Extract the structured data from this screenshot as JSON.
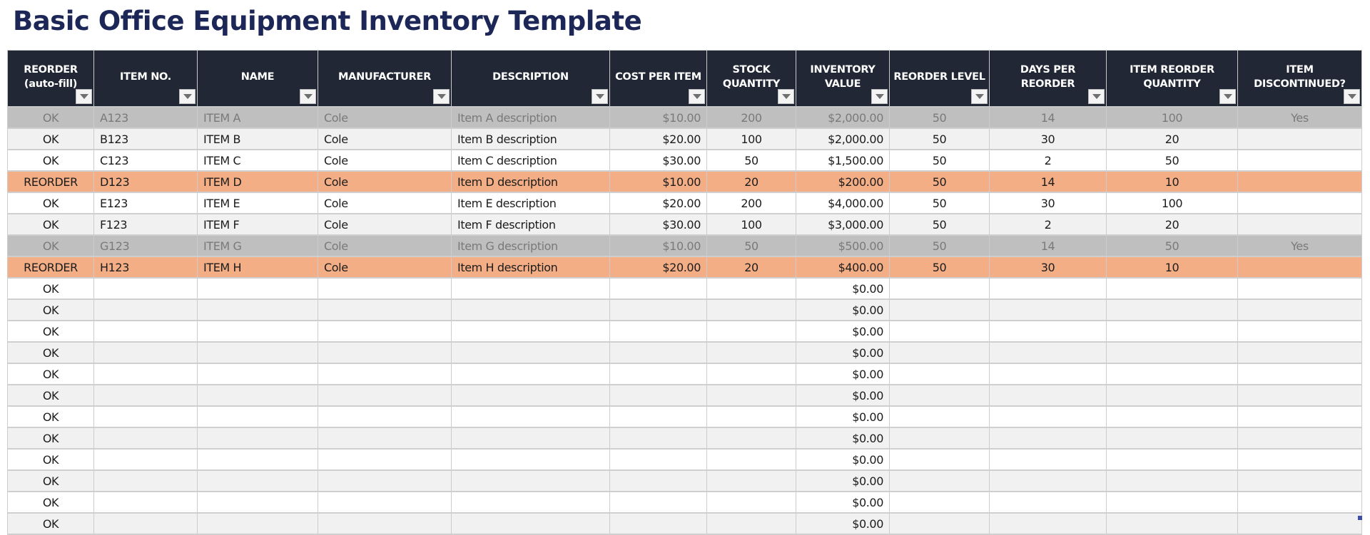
{
  "title": "Basic Office Equipment Inventory Template",
  "colors": {
    "header_bg": "#212735",
    "title_color": "#1d2757",
    "reorder_row": "#f3ae85",
    "discontinued_row": "#bfbfbf",
    "alt_row": "#f1f1f1"
  },
  "columns": [
    {
      "label": "REORDER (auto-fill)",
      "filter_icon": "filter-dropdown-icon"
    },
    {
      "label": "ITEM NO.",
      "filter_icon": "filter-dropdown-icon"
    },
    {
      "label": "NAME",
      "filter_icon": "filter-dropdown-icon"
    },
    {
      "label": "MANUFACTURER",
      "filter_icon": "filter-dropdown-icon"
    },
    {
      "label": "DESCRIPTION",
      "filter_icon": "filter-dropdown-icon"
    },
    {
      "label": "COST PER ITEM",
      "filter_icon": "filter-dropdown-icon"
    },
    {
      "label": "STOCK QUANTITY",
      "filter_icon": "filter-dropdown-icon"
    },
    {
      "label": "INVENTORY VALUE",
      "filter_icon": "filter-dropdown-icon"
    },
    {
      "label": "REORDER LEVEL",
      "filter_icon": "filter-dropdown-icon"
    },
    {
      "label": "DAYS PER REORDER",
      "filter_icon": "filter-dropdown-icon"
    },
    {
      "label": "ITEM REORDER QUANTITY",
      "filter_icon": "filter-dropdown-icon"
    },
    {
      "label": "ITEM DISCONTINUED?",
      "filter_icon": "filter-dropdown-icon"
    }
  ],
  "rows": [
    {
      "status": "disc",
      "cells": [
        "OK",
        "A123",
        "ITEM A",
        "Cole",
        "Item A description",
        "$10.00",
        "200",
        "$2,000.00",
        "50",
        "14",
        "100",
        "Yes"
      ]
    },
    {
      "status": "g",
      "cells": [
        "OK",
        "B123",
        "ITEM B",
        "Cole",
        "Item B description",
        "$20.00",
        "100",
        "$2,000.00",
        "50",
        "30",
        "20",
        ""
      ]
    },
    {
      "status": "w",
      "cells": [
        "OK",
        "C123",
        "ITEM C",
        "Cole",
        "Item C description",
        "$30.00",
        "50",
        "$1,500.00",
        "50",
        "2",
        "50",
        ""
      ]
    },
    {
      "status": "reo",
      "cells": [
        "REORDER",
        "D123",
        "ITEM D",
        "Cole",
        "Item D description",
        "$10.00",
        "20",
        "$200.00",
        "50",
        "14",
        "10",
        ""
      ]
    },
    {
      "status": "w",
      "cells": [
        "OK",
        "E123",
        "ITEM E",
        "Cole",
        "Item E description",
        "$20.00",
        "200",
        "$4,000.00",
        "50",
        "30",
        "100",
        ""
      ]
    },
    {
      "status": "g",
      "cells": [
        "OK",
        "F123",
        "ITEM F",
        "Cole",
        "Item F description",
        "$30.00",
        "100",
        "$3,000.00",
        "50",
        "2",
        "20",
        ""
      ]
    },
    {
      "status": "disc",
      "cells": [
        "OK",
        "G123",
        "ITEM G",
        "Cole",
        "Item G description",
        "$10.00",
        "50",
        "$500.00",
        "50",
        "14",
        "50",
        "Yes"
      ]
    },
    {
      "status": "reo",
      "cells": [
        "REORDER",
        "H123",
        "ITEM H",
        "Cole",
        "Item H description",
        "$20.00",
        "20",
        "$400.00",
        "50",
        "30",
        "10",
        ""
      ]
    },
    {
      "status": "w",
      "cells": [
        "OK",
        "",
        "",
        "",
        "",
        "",
        "",
        "$0.00",
        "",
        "",
        "",
        ""
      ]
    },
    {
      "status": "g",
      "cells": [
        "OK",
        "",
        "",
        "",
        "",
        "",
        "",
        "$0.00",
        "",
        "",
        "",
        ""
      ]
    },
    {
      "status": "w",
      "cells": [
        "OK",
        "",
        "",
        "",
        "",
        "",
        "",
        "$0.00",
        "",
        "",
        "",
        ""
      ]
    },
    {
      "status": "g",
      "cells": [
        "OK",
        "",
        "",
        "",
        "",
        "",
        "",
        "$0.00",
        "",
        "",
        "",
        ""
      ]
    },
    {
      "status": "w",
      "cells": [
        "OK",
        "",
        "",
        "",
        "",
        "",
        "",
        "$0.00",
        "",
        "",
        "",
        ""
      ]
    },
    {
      "status": "g",
      "cells": [
        "OK",
        "",
        "",
        "",
        "",
        "",
        "",
        "$0.00",
        "",
        "",
        "",
        ""
      ]
    },
    {
      "status": "w",
      "cells": [
        "OK",
        "",
        "",
        "",
        "",
        "",
        "",
        "$0.00",
        "",
        "",
        "",
        ""
      ]
    },
    {
      "status": "g",
      "cells": [
        "OK",
        "",
        "",
        "",
        "",
        "",
        "",
        "$0.00",
        "",
        "",
        "",
        ""
      ]
    },
    {
      "status": "w",
      "cells": [
        "OK",
        "",
        "",
        "",
        "",
        "",
        "",
        "$0.00",
        "",
        "",
        "",
        ""
      ]
    },
    {
      "status": "g",
      "cells": [
        "OK",
        "",
        "",
        "",
        "",
        "",
        "",
        "$0.00",
        "",
        "",
        "",
        ""
      ]
    },
    {
      "status": "w",
      "cells": [
        "OK",
        "",
        "",
        "",
        "",
        "",
        "",
        "$0.00",
        "",
        "",
        "",
        ""
      ]
    },
    {
      "status": "g",
      "cells": [
        "OK",
        "",
        "",
        "",
        "",
        "",
        "",
        "$0.00",
        "",
        "",
        "",
        ""
      ]
    }
  ]
}
